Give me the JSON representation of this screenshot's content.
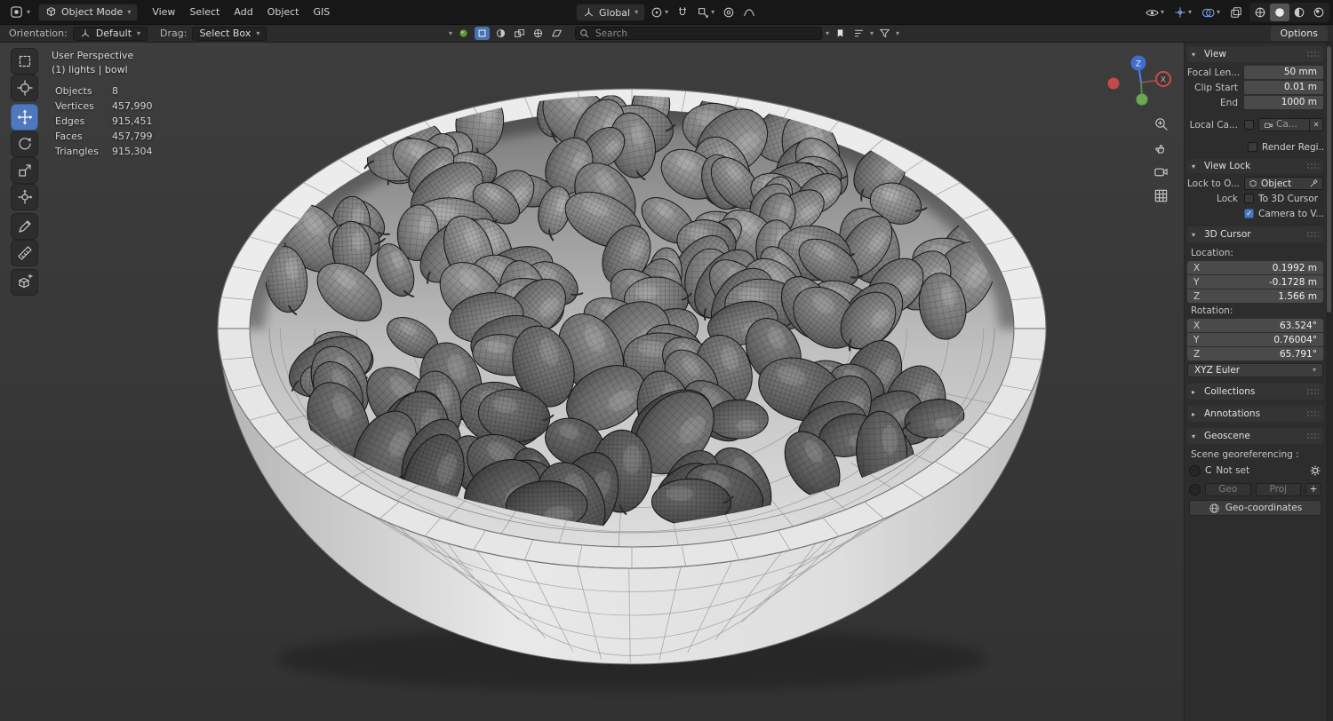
{
  "icons": {
    "caret": "▾",
    "chevron_down": "▾",
    "chevron_right": "▸",
    "check": "✓",
    "close": "✕"
  },
  "header": {
    "mode": "Object Mode",
    "menus": [
      {
        "label": "View"
      },
      {
        "label": "Select"
      },
      {
        "label": "Add"
      },
      {
        "label": "Object"
      },
      {
        "label": "GIS"
      }
    ],
    "orientation": "Global",
    "options_button": "Options"
  },
  "tool_settings": {
    "orientation_label": "Orientation:",
    "orientation_value": "Default",
    "drag_label": "Drag:",
    "drag_value": "Select Box",
    "search_placeholder": "Search"
  },
  "viewport": {
    "view_label": "User Perspective",
    "scene_path": "(1) lights | bowl",
    "stats": [
      {
        "label": "Objects",
        "value": "8"
      },
      {
        "label": "Vertices",
        "value": "457,990"
      },
      {
        "label": "Edges",
        "value": "915,451"
      },
      {
        "label": "Faces",
        "value": "457,799"
      },
      {
        "label": "Triangles",
        "value": "915,304"
      }
    ],
    "gizmo": {
      "z": "Z",
      "x": "X"
    }
  },
  "sidebar": {
    "view": {
      "title": "View",
      "focal_label": "Focal Len...",
      "focal_value": "50 mm",
      "clip_start_label": "Clip Start",
      "clip_start_value": "0.01 m",
      "clip_end_label": "End",
      "clip_end_value": "1000 m",
      "local_camera_label": "Local Ca...",
      "local_camera_value": "Ca...",
      "render_region_label": "Render Regi...",
      "view_lock": {
        "title": "View Lock",
        "lock_to_label": "Lock to O...",
        "lock_to_value": "Object",
        "lock_label": "Lock",
        "to_3d_cursor": "To 3D Cursor",
        "camera_to_view": "Camera to V..."
      }
    },
    "cursor3d": {
      "title": "3D Cursor",
      "location_label": "Location:",
      "location": [
        {
          "axis": "X",
          "value": "0.1992 m"
        },
        {
          "axis": "Y",
          "value": "-0.1728 m"
        },
        {
          "axis": "Z",
          "value": "1.566 m"
        }
      ],
      "rotation_label": "Rotation:",
      "rotation": [
        {
          "axis": "X",
          "value": "63.524°"
        },
        {
          "axis": "Y",
          "value": "0.76004°"
        },
        {
          "axis": "Z",
          "value": "65.791°"
        }
      ],
      "euler_mode": "XYZ Euler"
    },
    "collections": {
      "title": "Collections"
    },
    "annotations": {
      "title": "Annotations"
    },
    "geoscene": {
      "title": "Geoscene",
      "georef_label": "Scene georeferencing :",
      "crs_code": "C",
      "crs_status": "Not set",
      "geo_button": "Geo",
      "proj_button": "Proj",
      "add_button": "+",
      "coords_button": "Geo-coordinates"
    }
  }
}
